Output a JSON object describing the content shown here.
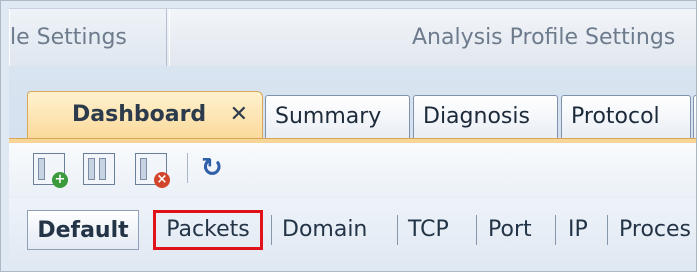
{
  "top_tabs": [
    {
      "label": "le Settings"
    },
    {
      "label": "Analysis Profile Settings"
    }
  ],
  "doc_tabs": [
    {
      "label": "Dashboard",
      "close": "✕",
      "active": true
    },
    {
      "label": "Summary"
    },
    {
      "label": "Diagnosis"
    },
    {
      "label": "Protocol"
    }
  ],
  "toolbar": {
    "icons": [
      "add-view-icon",
      "view-layout-icon",
      "delete-view-icon",
      "refresh-icon"
    ],
    "refresh_glyph": "↻"
  },
  "views": [
    {
      "label": "Default",
      "selected": true
    },
    {
      "label": "Packets",
      "highlighted": true
    },
    {
      "label": "Domain"
    },
    {
      "label": "TCP"
    },
    {
      "label": "Port"
    },
    {
      "label": "IP"
    },
    {
      "label": "Proces"
    }
  ],
  "colors": {
    "active_tab": "#fbd99a",
    "highlight_border": "#e0131b",
    "panel": "#d9e4f1"
  }
}
